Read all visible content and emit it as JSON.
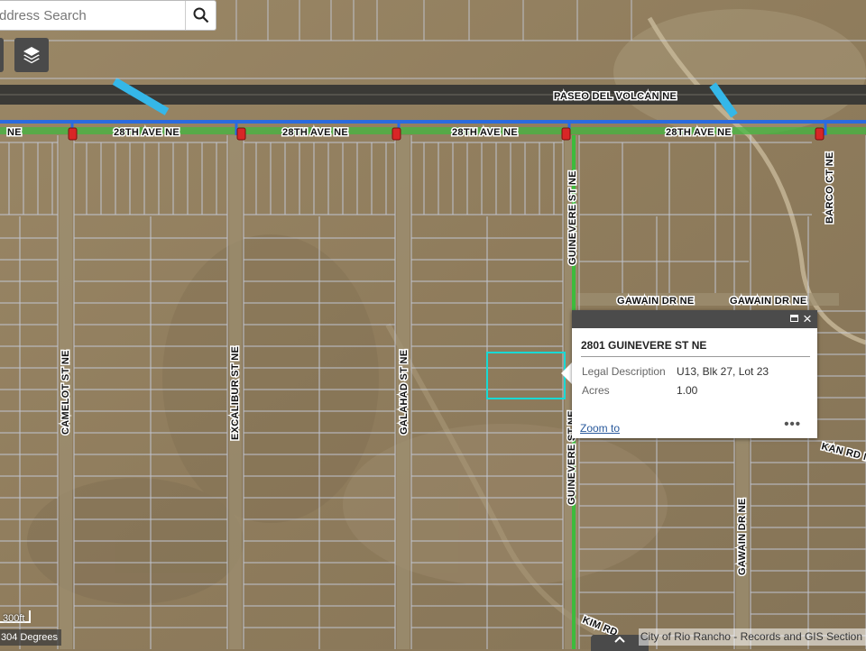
{
  "search": {
    "placeholder": "ddress Search"
  },
  "map": {
    "highway_label": "PASEO DEL VOLCAN NE",
    "street_labels": [
      {
        "id": "label-28th-0",
        "text": "NE"
      },
      {
        "id": "label-28th-1",
        "text": "28TH AVE NE"
      },
      {
        "id": "label-28th-2",
        "text": "28TH AVE NE"
      },
      {
        "id": "label-28th-3",
        "text": "28TH AVE NE"
      },
      {
        "id": "label-28th-4",
        "text": "28TH AVE NE"
      },
      {
        "id": "label-barco",
        "text": "BARCO CT NE"
      },
      {
        "id": "label-guinevere-n",
        "text": "GUINEVERE ST NE"
      },
      {
        "id": "label-gawain-dr-1",
        "text": "GAWAIN DR NE"
      },
      {
        "id": "label-gawain-dr-2",
        "text": "GAWAIN DR NE"
      },
      {
        "id": "label-camelot",
        "text": "CAMELOT ST NE"
      },
      {
        "id": "label-excalibur",
        "text": "EXCALIBUR ST NE"
      },
      {
        "id": "label-galahad",
        "text": "GALAHAD ST NE"
      },
      {
        "id": "label-guinevere-s",
        "text": "GUINEVERE ST NE"
      },
      {
        "id": "label-kan",
        "text": "KAN RD NE"
      },
      {
        "id": "label-gawain-s",
        "text": "GAWAIN DR NE"
      },
      {
        "id": "label-kim",
        "text": "KIM RD"
      }
    ]
  },
  "popup": {
    "title": "2801 GUINEVERE ST NE",
    "attributes": [
      {
        "name": "Legal Description",
        "value": "U13, Blk 27, Lot 23"
      },
      {
        "name": "Acres",
        "value": "1.00"
      }
    ],
    "zoom_link": "Zoom to",
    "more": "•••",
    "close": "×"
  },
  "footer": {
    "scale": "300ft",
    "heading": "304 Degrees",
    "attribution": "City of Rio Rancho - Records and GIS Section"
  },
  "colors": {
    "parcel_line": "#c9d1e4",
    "selected_parcel": "#19d9d4",
    "trail": "#3dbb3d",
    "water_main": "#2a6be0",
    "highway_bridge": "#35b7e8"
  },
  "icons": {
    "search": "search-icon",
    "layers": "layers-icon",
    "hydrant": "hydrant-icon",
    "maximize": "maximize-icon",
    "close": "close-icon"
  }
}
